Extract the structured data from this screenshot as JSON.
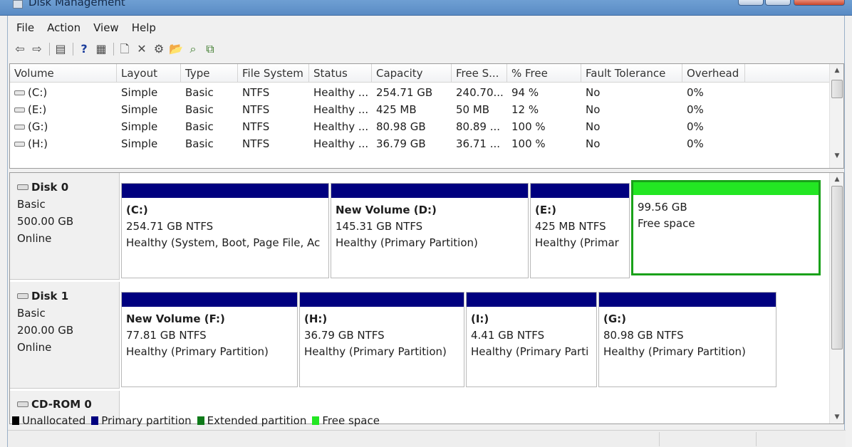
{
  "window": {
    "title": "Disk Management"
  },
  "menu": [
    "File",
    "Action",
    "View",
    "Help"
  ],
  "toolbar": [
    "back-arrow-icon",
    "forward-arrow-icon",
    "sep",
    "console-tree-icon",
    "sep",
    "help-icon",
    "list-icon",
    "sep",
    "properties-icon",
    "delete-icon",
    "settings-icon",
    "open-folder-icon",
    "search-icon",
    "connect-icon"
  ],
  "columns": [
    "Volume",
    "Layout",
    "Type",
    "File System",
    "Status",
    "Capacity",
    "Free S...",
    "% Free",
    "Fault Tolerance",
    "Overhead"
  ],
  "volumes": [
    [
      "(C:)",
      "Simple",
      "Basic",
      "NTFS",
      "Healthy ...",
      "254.71 GB",
      "240.70...",
      "94 %",
      "No",
      "0%"
    ],
    [
      "(E:)",
      "Simple",
      "Basic",
      "NTFS",
      "Healthy ...",
      "425 MB",
      "50 MB",
      "12 %",
      "No",
      "0%"
    ],
    [
      "(G:)",
      "Simple",
      "Basic",
      "NTFS",
      "Healthy ...",
      "80.98 GB",
      "80.89 ...",
      "100 %",
      "No",
      "0%"
    ],
    [
      "(H:)",
      "Simple",
      "Basic",
      "NTFS",
      "Healthy ...",
      "36.79 GB",
      "36.71 ...",
      "100 %",
      "No",
      "0%"
    ]
  ],
  "disks": [
    {
      "name": "Disk 0",
      "type": "Basic",
      "size": "500.00 GB",
      "status": "Online",
      "partitions": [
        {
          "name": "(C:)",
          "size": "254.71 GB NTFS",
          "status": "Healthy (System, Boot, Page File, Ac",
          "kind": "primary"
        },
        {
          "name": "New Volume  (D:)",
          "size": "145.31 GB NTFS",
          "status": "Healthy (Primary Partition)",
          "kind": "primary"
        },
        {
          "name": "(E:)",
          "size": "425 MB NTFS",
          "status": "Healthy (Primar",
          "kind": "primary"
        },
        {
          "name": "",
          "size": "99.56 GB",
          "status": "Free space",
          "kind": "free"
        }
      ]
    },
    {
      "name": "Disk 1",
      "type": "Basic",
      "size": "200.00 GB",
      "status": "Online",
      "partitions": [
        {
          "name": "New Volume  (F:)",
          "size": "77.81 GB NTFS",
          "status": "Healthy (Primary Partition)",
          "kind": "primary"
        },
        {
          "name": "(H:)",
          "size": "36.79 GB NTFS",
          "status": "Healthy (Primary Partition)",
          "kind": "primary"
        },
        {
          "name": "(I:)",
          "size": "4.41 GB NTFS",
          "status": "Healthy (Primary Parti",
          "kind": "primary"
        },
        {
          "name": "(G:)",
          "size": "80.98 GB NTFS",
          "status": "Healthy (Primary Partition)",
          "kind": "primary"
        }
      ]
    }
  ],
  "cdrom": {
    "name": "CD-ROM 0"
  },
  "legend": [
    {
      "label": "Unallocated",
      "color": "#000000"
    },
    {
      "label": "Primary partition",
      "color": "#00007f"
    },
    {
      "label": "Extended partition",
      "color": "#0f7a1a"
    },
    {
      "label": "Free space",
      "color": "#23e623"
    }
  ]
}
